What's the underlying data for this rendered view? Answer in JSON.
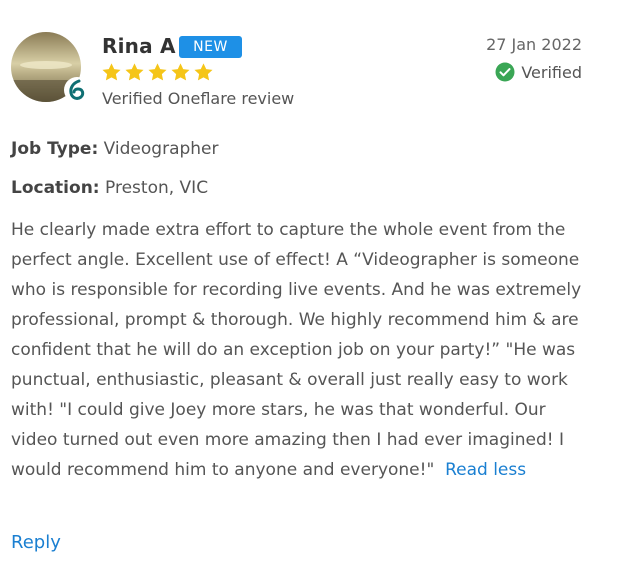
{
  "review": {
    "reviewer_name": "Rina A",
    "new_badge": "NEW",
    "rating": 5,
    "rating_max": 5,
    "source_label": "Verified Oneflare review",
    "date": "27 Jan 2022",
    "verified_label": "Verified",
    "job_type_label": "Job Type:",
    "job_type_value": "Videographer",
    "location_label": "Location:",
    "location_value": "Preston, VIC",
    "text": "He clearly made extra effort to capture the whole event from the perfect angle. Excellent use of effect! A “Videographer is someone who is responsible for recording live events. And he was extremely professional, prompt & thorough. We highly recommend him & are confident that he will do an exception job on your party!” \"He was punctual, enthusiastic, pleasant & overall just really easy to work with! \"I could give Joey more stars, he was that wonderful. Our video turned out even more amazing then I had ever imagined! I would recommend him to anyone and everyone!\"",
    "read_less": "Read less",
    "reply": "Reply"
  },
  "icons": {
    "avatar_badge": "oneflare-logo-icon",
    "star": "star-icon",
    "verified": "check-circle-icon"
  },
  "colors": {
    "accent_blue": "#1e90e6",
    "link_blue": "#1a7fd1",
    "star_gold": "#f5c518",
    "verified_green": "#3aa655",
    "badge_teal": "#0f6f73"
  }
}
